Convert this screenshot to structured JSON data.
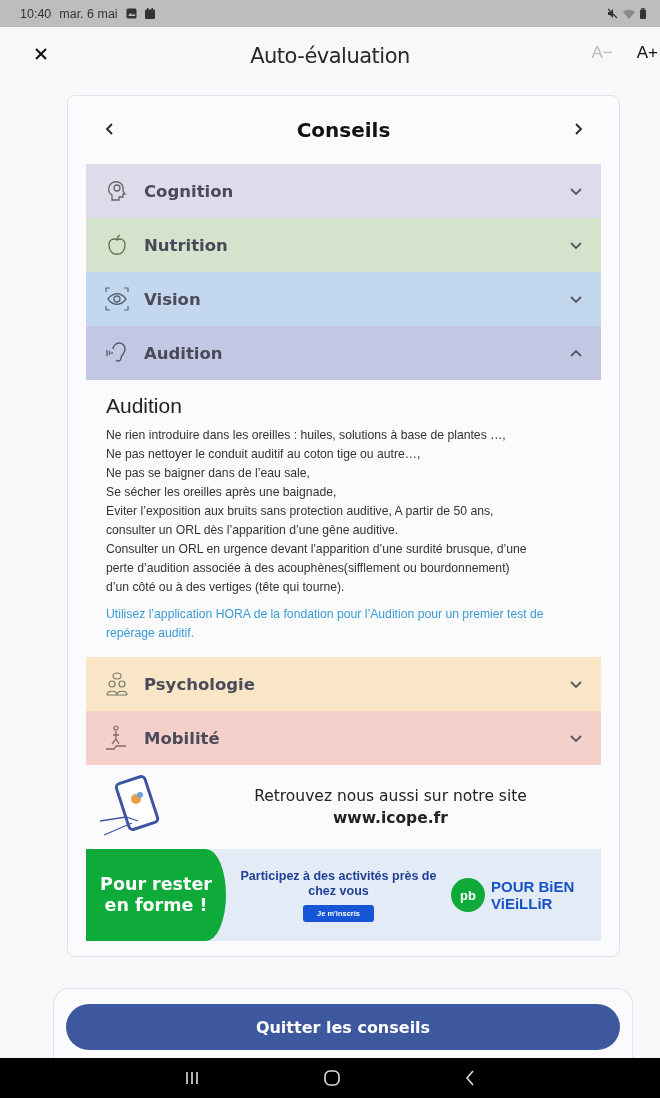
{
  "status_bar": {
    "time": "10:40",
    "date": "mar. 6 mai"
  },
  "header": {
    "title": "Auto-évaluation",
    "font_buttons": [
      {
        "label": "A−",
        "disabled": true
      },
      {
        "label": "A+",
        "disabled": false
      }
    ]
  },
  "card": {
    "title": "Conseils"
  },
  "sections": [
    {
      "label": "Cognition",
      "kind": "cognition",
      "color": "#dedbea",
      "expanded": false
    },
    {
      "label": "Nutrition",
      "kind": "nutrition",
      "color": "#d3e3cc",
      "expanded": false
    },
    {
      "label": "Vision",
      "kind": "vision",
      "color": "#c3d8ee",
      "expanded": false
    },
    {
      "label": "Audition",
      "kind": "audition",
      "color": "#c2c8e3",
      "expanded": true,
      "content": {
        "title": "Audition",
        "lines": [
          "Ne rien introduire dans les oreilles : huiles, solutions à base de plantes …,",
          "Ne pas nettoyer le conduit auditif au coton tige ou autre…,",
          "Ne pas se baigner dans de l’eau sale,",
          "Se sécher les oreilles après une baignade,",
          "Eviter l’exposition aux bruits sans protection auditive,  A partir de 50 ans,",
          "consulter un ORL dès l’apparition d’une gêne auditive.",
          "Consulter un ORL en urgence devant l'apparition d’une surdité brusque, d’une",
          "perte d’audition associée à des acouphènes(sifflement ou bourdonnement)",
          "d’un côté ou à des vertiges (tête qui tourne)."
        ],
        "link": "Utilisez l’application HORA de la fondation pour l’Audition pour un premier test de repérage auditif."
      }
    },
    {
      "label": "Psychologie",
      "kind": "psychologie",
      "color": "#f8e6c6",
      "expanded": false
    },
    {
      "label": "Mobilité",
      "kind": "mobilite",
      "color": "#f5cfc9",
      "expanded": false
    }
  ],
  "website": {
    "text": "Retrouvez nous aussi sur notre site",
    "url": "www.icope.fr"
  },
  "banner": {
    "headline": "Pour rester en forme !",
    "text": "Participez à des activités près de chez vous",
    "button": "Je m'inscris",
    "logo_mark": "pb",
    "logo_text": "POUR BiEN ViEiLLiR"
  },
  "footer": {
    "button": "Quitter les conseils"
  }
}
